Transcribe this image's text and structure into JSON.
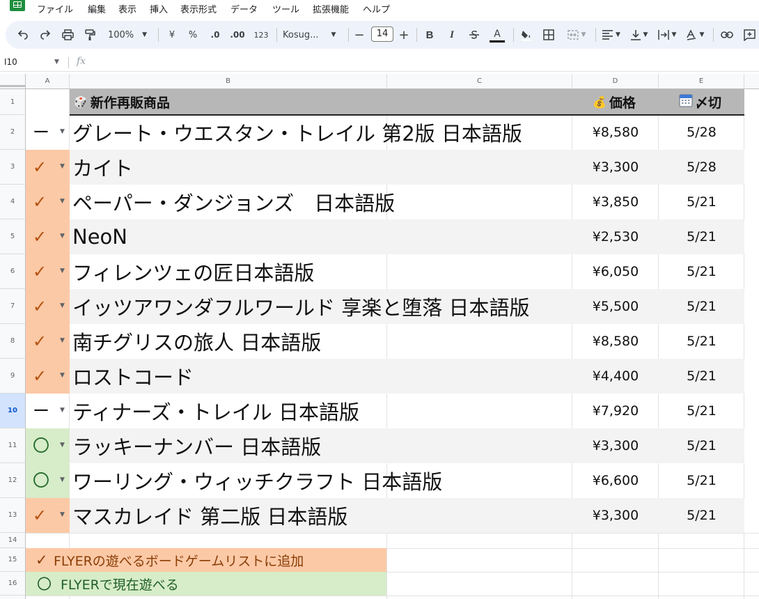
{
  "menu": {
    "items": [
      "ファイル",
      "編集",
      "表示",
      "挿入",
      "表示形式",
      "データ",
      "ツール",
      "拡張機能",
      "ヘルプ"
    ]
  },
  "toolbar": {
    "zoom": "100%",
    "currency": "¥",
    "percent": "%",
    "dec_decrease": ".0",
    "dec_increase": ".00",
    "number_format": "123",
    "font": "Kosug...",
    "font_size": "14",
    "text_color_letter": "A",
    "text_color_hex": "#000000",
    "fill_color_hex": "#ffffff",
    "minus": "−",
    "plus": "+"
  },
  "formula_bar": {
    "cell_ref": "I10",
    "fx": "fx",
    "content": ""
  },
  "columns": [
    "A",
    "B",
    "C",
    "D",
    "E"
  ],
  "row_numbers": [
    "1",
    "2",
    "3",
    "4",
    "5",
    "6",
    "7",
    "8",
    "9",
    "10",
    "11",
    "12",
    "13",
    "14",
    "15",
    "16"
  ],
  "selected_row": "10",
  "header": {
    "product_icon": "🎲",
    "product": "新作再販商品",
    "price_icon": "💰",
    "price": "価格",
    "deadline_icon": "calendar-icon",
    "deadline": "〆切"
  },
  "rows": [
    {
      "status": "ー",
      "status_type": "dash",
      "name": "グレート・ウエスタン・トレイル 第2版 日本語版",
      "price": "¥8,580",
      "deadline": "5/28"
    },
    {
      "status": "✓",
      "status_type": "check",
      "name": "カイト",
      "price": "¥3,300",
      "deadline": "5/28"
    },
    {
      "status": "✓",
      "status_type": "check",
      "name": "ペーパー・ダンジョンズ　日本語版",
      "price": "¥3,850",
      "deadline": "5/21"
    },
    {
      "status": "✓",
      "status_type": "check",
      "name": "NeoN",
      "price": "¥2,530",
      "deadline": "5/21"
    },
    {
      "status": "✓",
      "status_type": "check",
      "name": "フィレンツェの匠日本語版",
      "price": "¥6,050",
      "deadline": "5/21"
    },
    {
      "status": "✓",
      "status_type": "check",
      "name": "イッツアワンダフルワールド 享楽と堕落 日本語版",
      "price": "¥5,500",
      "deadline": "5/21"
    },
    {
      "status": "✓",
      "status_type": "check",
      "name": "南チグリスの旅人 日本語版",
      "price": "¥8,580",
      "deadline": "5/21"
    },
    {
      "status": "✓",
      "status_type": "check",
      "name": "ロストコード",
      "price": "¥4,400",
      "deadline": "5/21"
    },
    {
      "status": "ー",
      "status_type": "dash",
      "name": "ティナーズ・トレイル 日本語版",
      "price": "¥7,920",
      "deadline": "5/21"
    },
    {
      "status": "〇",
      "status_type": "circle",
      "name": "ラッキーナンバー 日本語版",
      "price": "¥3,300",
      "deadline": "5/21"
    },
    {
      "status": "〇",
      "status_type": "circle",
      "name": "ワーリング・ウィッチクラフト 日本語版",
      "price": "¥6,600",
      "deadline": "5/21"
    },
    {
      "status": "✓",
      "status_type": "check",
      "name": "マスカレイド 第二版 日本語版",
      "price": "¥3,300",
      "deadline": "5/21"
    }
  ],
  "legend": [
    {
      "symbol": "✓",
      "text": "FLYERの遊べるボードゲームリストに追加",
      "color": "#fcc9a6"
    },
    {
      "symbol": "〇",
      "text": "FLYERで現在遊べる",
      "color": "#d7ecc9"
    }
  ],
  "colors": {
    "check_fill": "#fcc9a6",
    "circle_fill": "#d7ecc9",
    "header_fill": "#b7b7b7",
    "stripe": "#f3f3f3",
    "selection": "#d3e3fd"
  }
}
